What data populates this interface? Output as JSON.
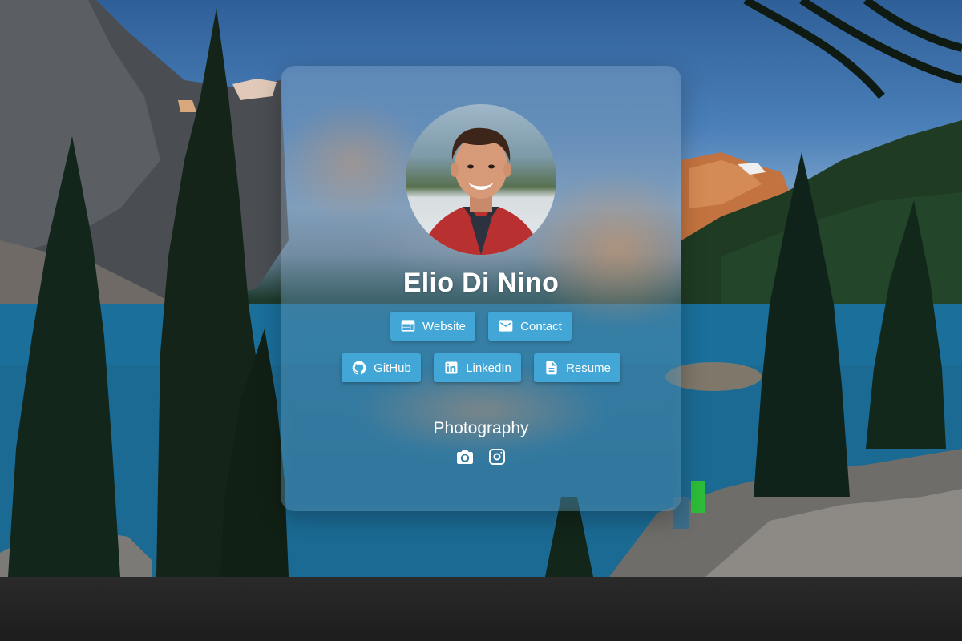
{
  "profile": {
    "name": "Elio Di Nino"
  },
  "buttons": [
    {
      "label": "Website",
      "icon": "web-icon"
    },
    {
      "label": "Contact",
      "icon": "mail-icon"
    },
    {
      "label": "GitHub",
      "icon": "github-icon"
    },
    {
      "label": "LinkedIn",
      "icon": "linkedin-icon"
    },
    {
      "label": "Resume",
      "icon": "document-icon"
    }
  ],
  "photography": {
    "title": "Photography",
    "links": [
      {
        "icon": "camera-icon"
      },
      {
        "icon": "instagram-icon"
      }
    ]
  },
  "colors": {
    "button": "#42a6d6",
    "text": "#ffffff"
  }
}
